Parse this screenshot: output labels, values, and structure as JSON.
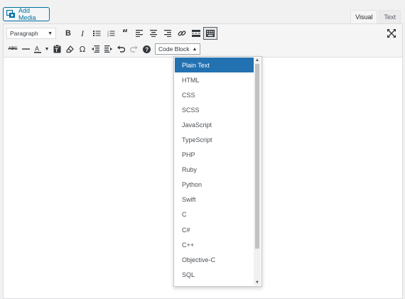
{
  "media": {
    "add_media_label": "Add Media"
  },
  "tabs": [
    {
      "label": "Visual",
      "active": true
    },
    {
      "label": "Text",
      "active": false
    }
  ],
  "toolbar": {
    "format_select": "Paragraph",
    "code_block_label": "Code Block",
    "row1_icons": [
      "bold-icon",
      "italic-icon",
      "bulleted-list-icon",
      "numbered-list-icon",
      "blockquote-icon",
      "align-left-icon",
      "align-center-icon",
      "align-right-icon",
      "link-icon",
      "read-more-icon",
      "toolbar-toggle-icon",
      "fullscreen-icon"
    ],
    "row2_icons": [
      "strikethrough-icon",
      "horizontal-line-icon",
      "text-color-icon",
      "paste-as-text-icon",
      "clear-formatting-icon",
      "special-character-icon",
      "outdent-icon",
      "indent-icon",
      "undo-icon",
      "redo-icon",
      "help-icon"
    ]
  },
  "code_block_dropdown": {
    "selected": "Plain Text",
    "options": [
      "Plain Text",
      "HTML",
      "CSS",
      "SCSS",
      "JavaScript",
      "TypeScript",
      "PHP",
      "Ruby",
      "Python",
      "Swift",
      "C",
      "C#",
      "C++",
      "Objective-C",
      "SQL"
    ]
  },
  "colors": {
    "accent": "#2271b1",
    "button_blue": "#0071a1",
    "toolbar_bg": "#f5f5f5"
  }
}
